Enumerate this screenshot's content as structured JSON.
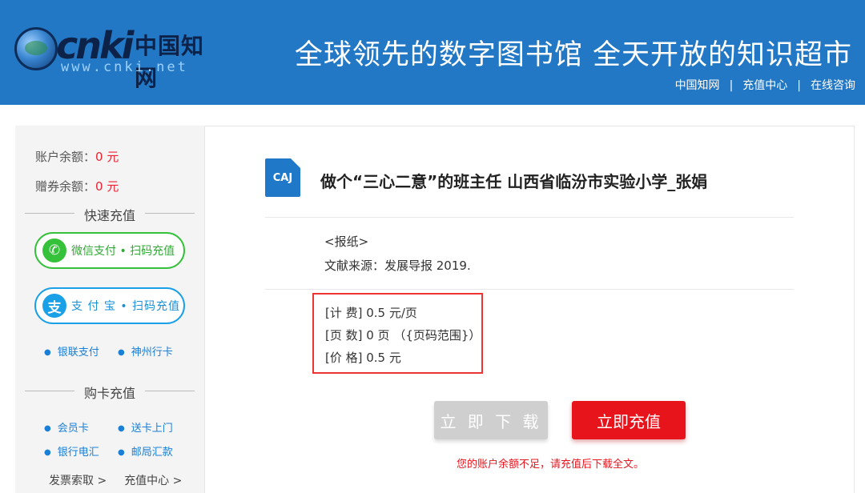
{
  "header": {
    "logo": {
      "letters": "cnki",
      "cn": "中国知网",
      "url": "www.cnki.net"
    },
    "slogan": "全球领先的数字图书馆 全天开放的知识超市",
    "links": [
      "中国知网",
      "充值中心",
      "在线咨询"
    ],
    "separator": "|",
    "bg_color": "#2278c4"
  },
  "sidebar": {
    "account_balance_label": "账户余额：",
    "account_balance_value": "0",
    "coupon_balance_label": "赠券余额：",
    "coupon_balance_value": "0",
    "currency": "元",
    "quick_recharge_title": "快速充值",
    "wechat_button": "微信支付 • 扫码充值",
    "alipay_button": "支 付 宝 • 扫码充值",
    "quick_links": [
      "银联支付",
      "神州行卡"
    ],
    "card_recharge_title": "购卡充值",
    "card_links_row1": [
      "会员卡",
      "送卡上门"
    ],
    "card_links_row2": [
      "银行电汇",
      "邮局汇款"
    ],
    "bottom_links": [
      "发票索取 >",
      "充值中心 >"
    ]
  },
  "main": {
    "file_type_icon": "CAJ",
    "title": "做个“三心二意”的班主任 山西省临汾市实验小学_张娟",
    "doc_type": "<报纸>",
    "source": "文献来源：发展导报 2019.",
    "fee": "[计 费] 0.5 元/页",
    "pages": "[页 数] 0 页 （{页码范围}）",
    "price": "[价 格] 0.5 元",
    "download_button": "立 即 下 载",
    "recharge_button": "立即充值",
    "notice": "您的账户余额不足，请充值后下载全文。",
    "accent_color": "#e8141c"
  }
}
